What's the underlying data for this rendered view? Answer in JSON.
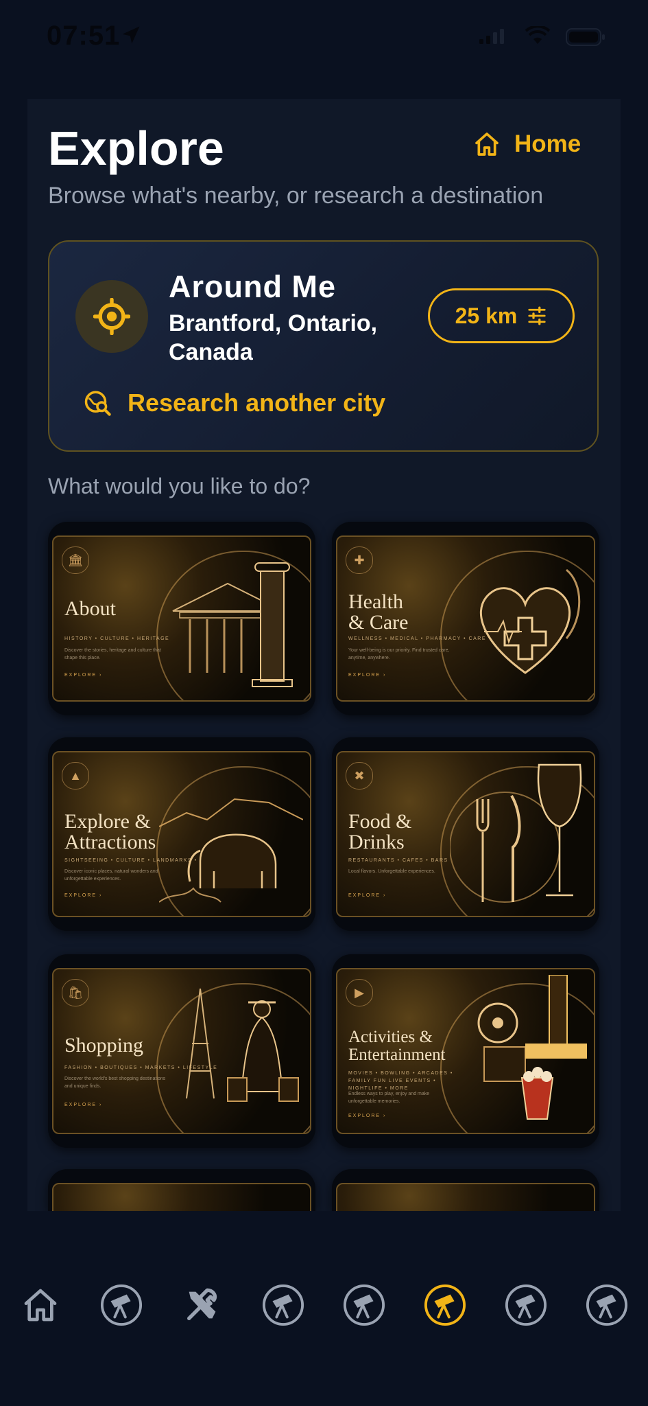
{
  "status_bar": {
    "time": "07:51"
  },
  "header": {
    "title": "Explore",
    "home_label": "Home",
    "subtitle": "Browse what's nearby, or research a destination"
  },
  "location_card": {
    "title": "Around Me",
    "location": "Brantford, Ontario, Canada",
    "radius": "25 km",
    "research_label": "Research another city"
  },
  "question": "What would you like to do?",
  "tiles": [
    {
      "name": "About",
      "tags": "HISTORY • CULTURE • HERITAGE",
      "desc": "Discover the stories, heritage and culture that shape this place.",
      "link": "EXPLORE ›",
      "icon": "column-icon"
    },
    {
      "name": "Health\n& Care",
      "tags": "WELLNESS • MEDICAL • PHARMACY • CARE",
      "desc": "Your well-being is our priority. Find trusted care, anytime, anywhere.",
      "link": "EXPLORE ›",
      "icon": "medical-cross-icon"
    },
    {
      "name": "Explore &\nAttractions",
      "tags": "SIGHTSEEING • CULTURE • LANDMARKS • TOURS",
      "desc": "Discover iconic places, natural wonders and unforgettable experiences.",
      "link": "EXPLORE ›",
      "icon": "mountain-icon"
    },
    {
      "name": "Food &\nDrinks",
      "tags": "RESTAURANTS • CAFES • BARS",
      "desc": "Local flavors. Unforgettable experiences.",
      "link": "EXPLORE ›",
      "icon": "cutlery-icon"
    },
    {
      "name": "Shopping",
      "tags": "FASHION • BOUTIQUES • MARKETS • LIFESTYLE",
      "desc": "Discover the world's best shopping destinations and unique finds.",
      "link": "EXPLORE ›",
      "icon": "shopping-bag-icon"
    },
    {
      "name": "Activities &\nEntertainment",
      "tags": "MOVIES • BOWLING • ARCADES • FAMILY FUN LIVE EVENTS • NIGHTLIFE • MORE",
      "desc": "Endless ways to play, enjoy and make unforgettable memories.",
      "link": "EXPLORE ›",
      "icon": "film-reel-icon"
    }
  ],
  "bottom_nav": [
    {
      "icon": "home-icon",
      "active": false
    },
    {
      "icon": "telescope-icon",
      "active": false
    },
    {
      "icon": "tools-icon",
      "active": false
    },
    {
      "icon": "telescope-icon",
      "active": false
    },
    {
      "icon": "telescope-icon",
      "active": false
    },
    {
      "icon": "telescope-icon",
      "active": true
    },
    {
      "icon": "telescope-icon",
      "active": false
    },
    {
      "icon": "telescope-icon",
      "active": false
    }
  ],
  "colors": {
    "accent": "#f2b417",
    "background": "#0a1120",
    "panel": "#101828",
    "muted_text": "#9aa3b2"
  }
}
